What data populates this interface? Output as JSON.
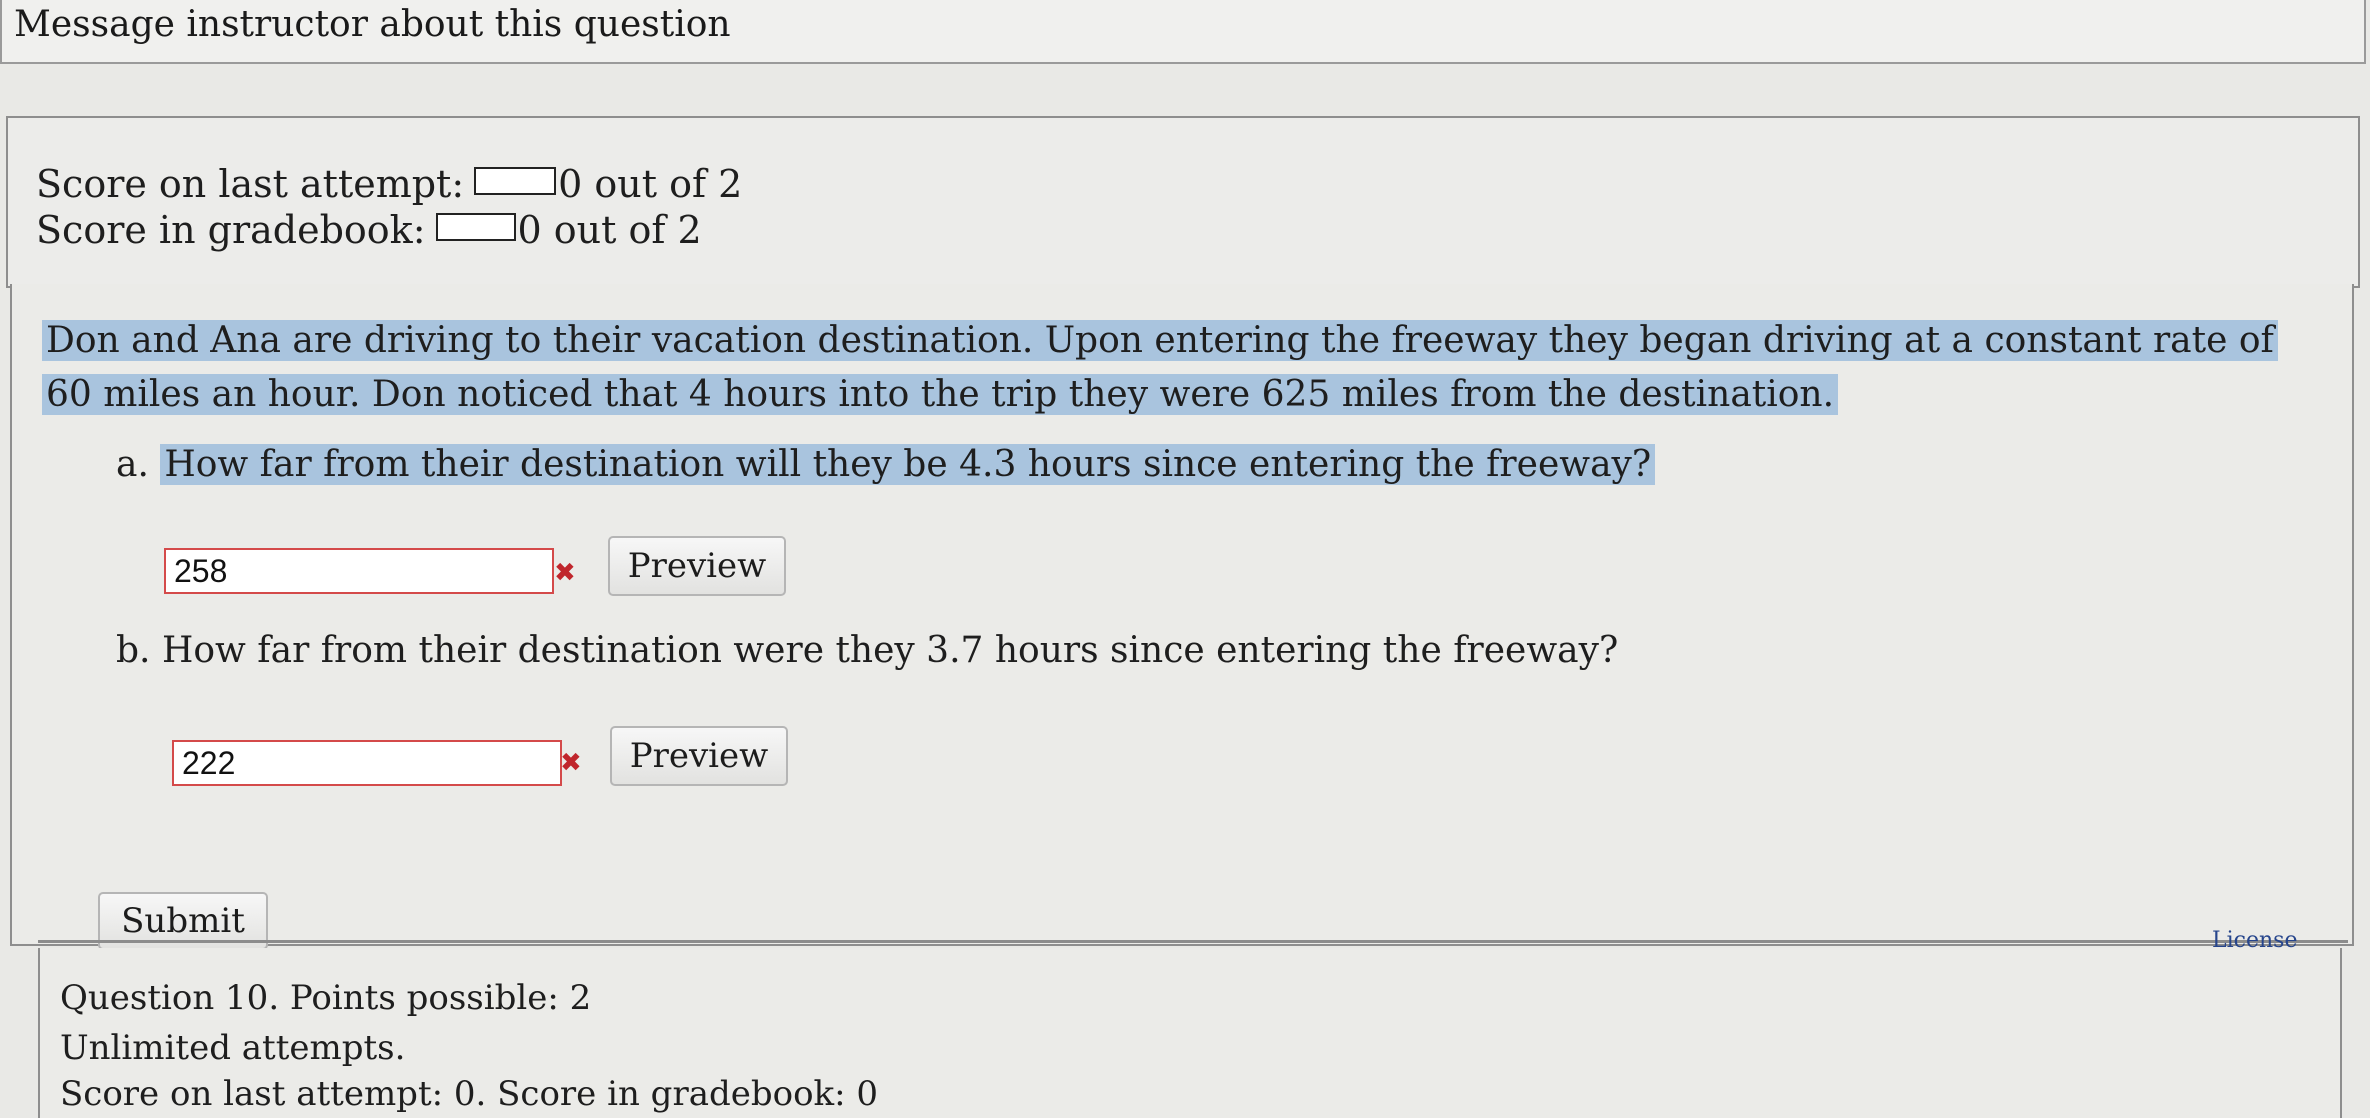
{
  "header": {
    "message_link": "Message instructor about this question"
  },
  "scores": {
    "last_attempt_label": "Score on last attempt:",
    "last_attempt_value": "0 out of 2",
    "gradebook_label": "Score in gradebook:",
    "gradebook_value": "0 out of 2"
  },
  "question": {
    "prompt": "Don and Ana are driving to their vacation destination. Upon entering the freeway they began driving at a constant rate of 60 miles an hour. Don noticed that 4 hours into the trip they were 625 miles from the destination.",
    "parts": [
      {
        "letter": "a.",
        "text": "How far from their destination will they be 4.3 hours since entering the freeway?",
        "answer": "258",
        "status_icon": "wrong-x-icon",
        "preview_label": "Preview"
      },
      {
        "letter": "b.",
        "text": "How far from their destination were they 3.7 hours since entering the freeway?",
        "answer": "222",
        "status_icon": "wrong-x-icon",
        "preview_label": "Preview"
      }
    ],
    "submit_label": "Submit",
    "license_label": "License"
  },
  "next_question": {
    "title": "Question 10. Points possible: 2",
    "attempts": "Unlimited attempts.",
    "score_line": "Score on last attempt: 0. Score in gradebook: 0"
  },
  "colors": {
    "highlight": "#a9c4de",
    "error_border": "#d44a4a",
    "error_icon": "#c0262c",
    "link": "#26458c"
  }
}
